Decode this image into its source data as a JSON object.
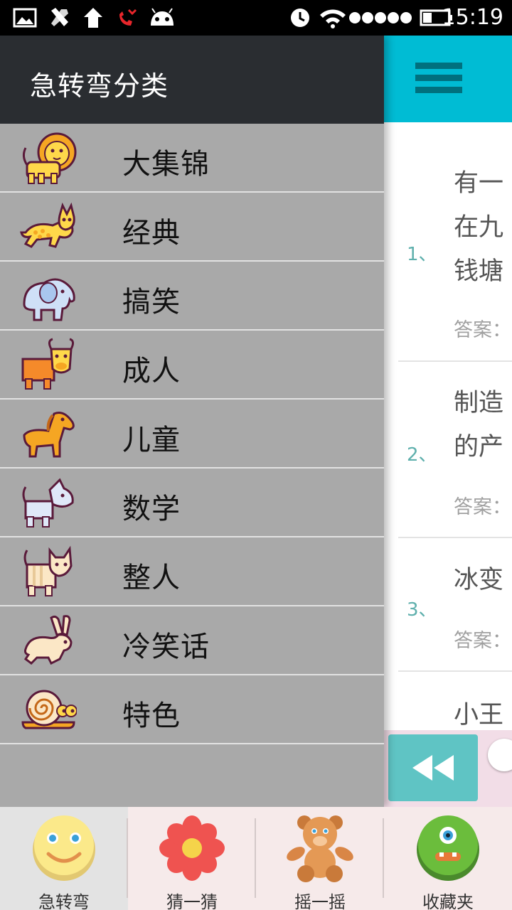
{
  "status_bar": {
    "time": "15:19",
    "icons": [
      "gallery-icon",
      "tools-icon",
      "upload-arrow-icon",
      "missed-call-icon",
      "android-icon",
      "alarm-icon",
      "wifi-icon",
      "signal-dots-icon",
      "battery-icon"
    ]
  },
  "drawer": {
    "title": "急转弯分类",
    "categories": [
      {
        "label": "大集锦",
        "icon": "lion-icon"
      },
      {
        "label": "经典",
        "icon": "cheetah-icon"
      },
      {
        "label": "搞笑",
        "icon": "elephant-icon"
      },
      {
        "label": "成人",
        "icon": "bull-icon"
      },
      {
        "label": "儿童",
        "icon": "horse-icon"
      },
      {
        "label": "数学",
        "icon": "dog-icon"
      },
      {
        "label": "整人",
        "icon": "cat-icon"
      },
      {
        "label": "冷笑话",
        "icon": "rabbit-icon"
      },
      {
        "label": "特色",
        "icon": "snail-icon"
      }
    ]
  },
  "main": {
    "menu_icon": "hamburger-menu-icon",
    "questions": [
      {
        "num": "1、",
        "lines": [
          "有一",
          "在九",
          "钱塘"
        ],
        "answer": "答案："
      },
      {
        "num": "2、",
        "lines": [
          "制造",
          "的产"
        ],
        "answer": "答案："
      },
      {
        "num": "3、",
        "lines": [
          "冰变"
        ],
        "answer": "答案："
      },
      {
        "num": "",
        "lines": [
          "小王"
        ],
        "answer": ""
      }
    ],
    "rewind_icon": "rewind-icon"
  },
  "tabs": [
    {
      "label": "急转弯",
      "icon": "smiley-face-icon",
      "active": true
    },
    {
      "label": "猜一猜",
      "icon": "flower-icon",
      "active": false
    },
    {
      "label": "摇一摇",
      "icon": "teddy-bear-icon",
      "active": false
    },
    {
      "label": "收藏夹",
      "icon": "one-eyed-monster-icon",
      "active": false
    }
  ],
  "colors": {
    "toolbar": "#00BCD4",
    "drawer_header": "#2a2d31",
    "drawer_bg": "#a9a9a9",
    "question_number": "#5fb0ad",
    "tabbar_bg": "#f6eaea"
  }
}
